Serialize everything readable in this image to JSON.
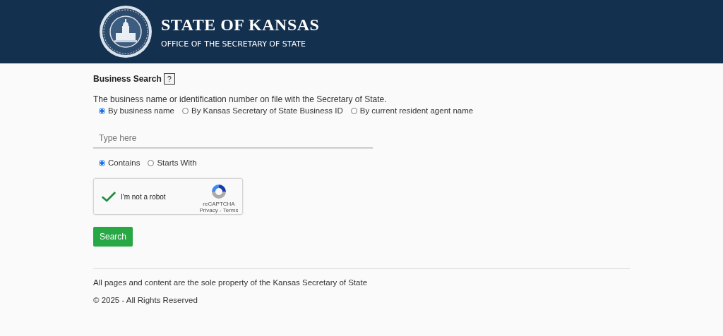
{
  "header": {
    "title": "STATE OF KANSAS",
    "subtitle": "OFFICE OF THE SECRETARY OF STATE"
  },
  "search": {
    "heading": "Business Search",
    "help": "?",
    "description": "The business name or identification number on file with the Secretary of State.",
    "search_by": [
      {
        "label": "By business name",
        "selected": true
      },
      {
        "label": "By Kansas Secretary of State Business ID",
        "selected": false
      },
      {
        "label": "By current resident agent name",
        "selected": false
      }
    ],
    "placeholder": "Type here",
    "match": [
      {
        "label": "Contains",
        "selected": true
      },
      {
        "label": "Starts With",
        "selected": false
      }
    ],
    "captcha": {
      "label": "I'm not a robot",
      "checked": true,
      "brand": "reCAPTCHA",
      "links": "Privacy - Terms"
    },
    "button": "Search"
  },
  "footer": {
    "notice": "All pages and content are the sole property of the Kansas Secretary of State",
    "copyright": "© 2025 - All Rights Reserved"
  }
}
